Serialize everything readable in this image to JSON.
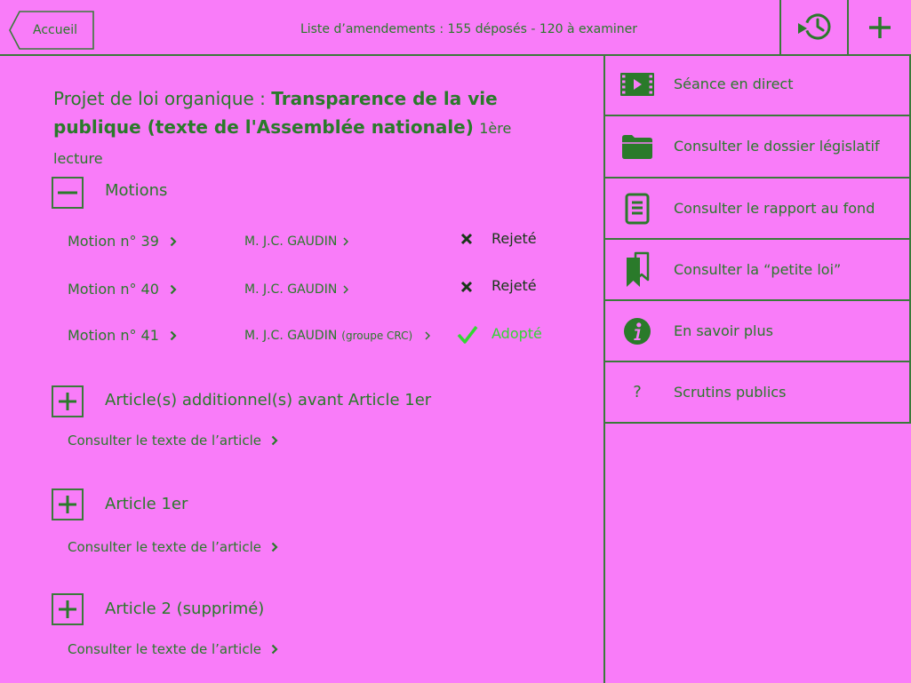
{
  "header": {
    "back_label": "Accueil",
    "back_icon": "back-arrow-icon",
    "summary": "Liste d’amendements : 155 déposés - 120 à examiner",
    "history_icon": "history-icon",
    "add_icon": "plus-icon"
  },
  "bill": {
    "type_label": "Projet de loi organique :",
    "title": "Transparence de la vie publique (texte de l'Assemblée nationale)",
    "reading": "1ère lecture"
  },
  "motions": {
    "label": "Motions",
    "expanded": true,
    "toggle_icon": "minus-icon",
    "items": [
      {
        "title": "Motion n° 39",
        "author": "M. J.C. GAUDIN",
        "result": "Rejeté",
        "result_icon": "cross-icon"
      },
      {
        "title": "Motion n° 40",
        "author": "M. J.C. GAUDIN",
        "result": "Rejeté",
        "result_icon": "cross-icon"
      },
      {
        "title": "Motion n° 41",
        "author": "M. J.C. GAUDIN",
        "group": "(groupe CRC)",
        "result": "Adopté",
        "result_icon": "check-icon"
      }
    ]
  },
  "sections": [
    {
      "title": "Article(s) additionnel(s) avant Article 1er",
      "expanded": false,
      "toggle_icon": "plus-icon",
      "link": "Consulter le texte de l’article"
    },
    {
      "title": "Article 1er",
      "expanded": false,
      "toggle_icon": "plus-icon",
      "link": "Consulter le texte de l’article"
    },
    {
      "title": "Article 2 (supprimé)",
      "expanded": false,
      "toggle_icon": "plus-icon",
      "link": "Consulter le texte de l’article"
    }
  ],
  "sidebar": {
    "items": [
      {
        "label": "Séance en direct",
        "icon": "video-icon"
      },
      {
        "label": "Consulter le dossier législatif",
        "icon": "folder-icon"
      },
      {
        "label": "Consulter le rapport au fond",
        "icon": "document-icon"
      },
      {
        "label": "Consulter la “petite loi”",
        "icon": "bookmarks-icon"
      },
      {
        "label": "En savoir plus",
        "icon": "info-icon"
      },
      {
        "label": "Scrutins publics",
        "icon": "question-icon",
        "glyph": "?"
      }
    ]
  },
  "colors": {
    "background": "#f97cf9",
    "text": "#2a7a2a",
    "border": "#3a7a3a",
    "rejected": "#173817",
    "adopted": "#33d633"
  }
}
